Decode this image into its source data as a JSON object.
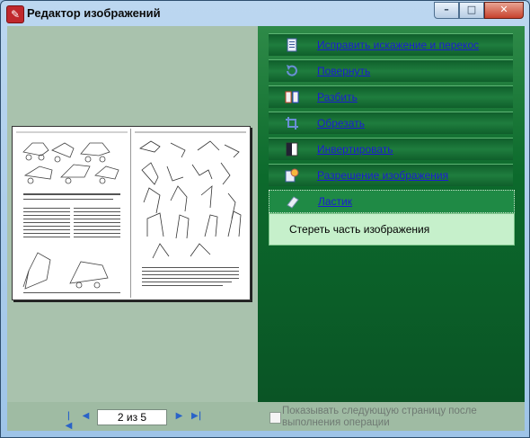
{
  "window": {
    "title": "Редактор изображений",
    "controls": {
      "minimize": "–",
      "maximize": "□",
      "close": "✕"
    }
  },
  "menu": {
    "items": [
      {
        "label": "Исправить искажение и перекос",
        "icon": "deskew-icon"
      },
      {
        "label": "Повернуть",
        "icon": "rotate-icon"
      },
      {
        "label": "Разбить",
        "icon": "split-icon"
      },
      {
        "label": "Обрезать",
        "icon": "crop-icon"
      },
      {
        "label": "Инвертировать",
        "icon": "invert-icon"
      },
      {
        "label": "Разрешение изображения",
        "icon": "resolution-icon"
      },
      {
        "label": "Ластик",
        "icon": "eraser-icon",
        "selected": true
      }
    ],
    "eraser_submenu": [
      "Стереть часть изображения"
    ]
  },
  "navigation": {
    "page_value": "2 из 5",
    "first": "|◀",
    "prev": "◀",
    "next": "▶",
    "last": "▶|"
  },
  "option": {
    "label": "Показывать следующую страницу после выполнения операции",
    "checked": false
  }
}
